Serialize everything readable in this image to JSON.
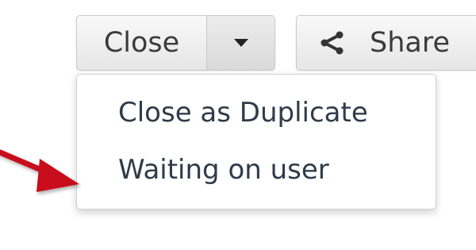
{
  "toolbar": {
    "close_label": "Close",
    "dropdown_toggle_icon": "caret-down-icon",
    "share_label": "Share",
    "share_icon": "share-icon"
  },
  "dropdown": {
    "items": [
      {
        "label": "Close as Duplicate"
      },
      {
        "label": "Waiting on user"
      }
    ]
  },
  "annotation": {
    "icon": "red-arrow-icon",
    "color": "#c8101a"
  },
  "colors": {
    "button_text": "#3b3b3b",
    "menu_text": "#2f3b48",
    "border": "#c9c9c9"
  }
}
